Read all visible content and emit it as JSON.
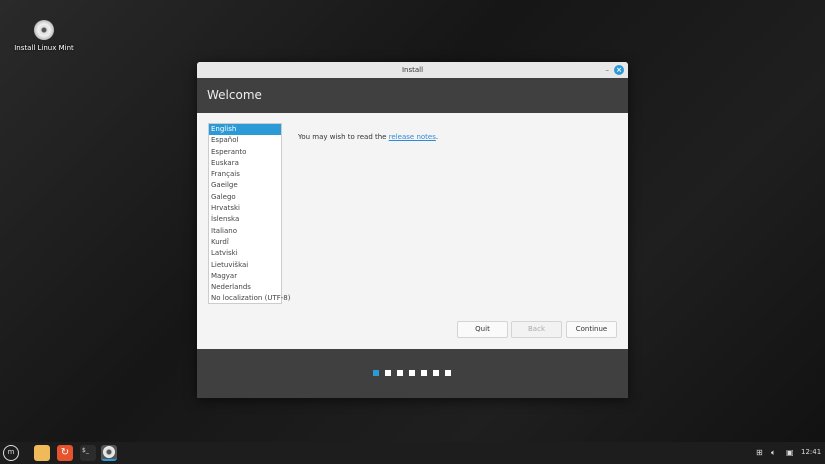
{
  "desktop": {
    "icon_label": "Install Linux Mint"
  },
  "window": {
    "title": "Install",
    "minimize": "–",
    "close": "×"
  },
  "header": {
    "title": "Welcome"
  },
  "languages": [
    "English",
    "Español",
    "Esperanto",
    "Euskara",
    "Français",
    "Gaeilge",
    "Galego",
    "Hrvatski",
    "Íslenska",
    "Italiano",
    "Kurdî",
    "Latviski",
    "Lietuviškai",
    "Magyar",
    "Nederlands",
    "No localization (UTF-8)"
  ],
  "selected_language": "English",
  "notes": {
    "prefix": "You may wish to read the ",
    "link": "release notes",
    "suffix": "."
  },
  "buttons": {
    "quit": "Quit",
    "back": "Back",
    "continue": "Continue"
  },
  "progress": {
    "current_step": 1,
    "total_steps": 7
  },
  "taskbar": {
    "clock": "12:41"
  },
  "colors": {
    "accent": "#2d9ad8",
    "header": "#404040"
  }
}
